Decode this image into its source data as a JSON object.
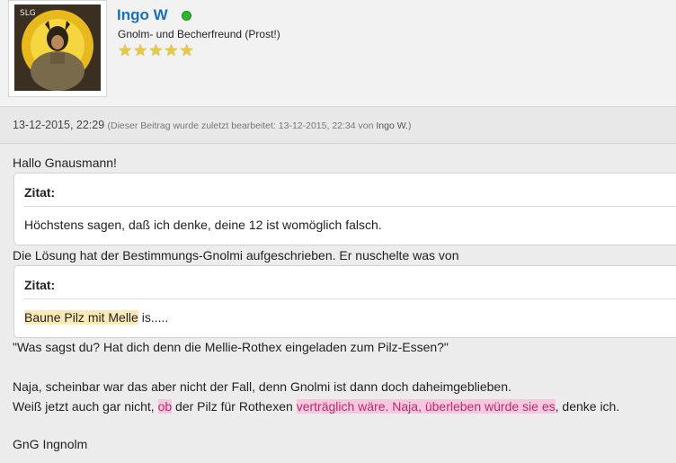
{
  "user": {
    "name": "Ingo W",
    "title": "Gnolm- und Becherfreund (Prost!)",
    "avatar_label": "SLG",
    "rating_stars": 5,
    "online_color": "#2fb52f"
  },
  "post": {
    "date": "13-12-2015, 22:29",
    "edit_prefix": "(Dieser Beitrag wurde zuletzt bearbeitet: 13-12-2015, 22:34 von",
    "edit_user": "Ingo W.",
    "edit_suffix": ")",
    "greeting": "Hallo Gnausmann!",
    "quote1": {
      "label": "Zitat:",
      "text": "Höchstens sagen, daß ich denke, deine 12 ist womöglich falsch."
    },
    "after_quote1": "Die Lösung hat der Bestimmungs-Gnolmi aufgeschrieben. Er nuschelte was von",
    "quote2": {
      "label": "Zitat:",
      "highlight": "Baune Pilz mit Melle",
      "rest": " is....."
    },
    "question": "\"Was sagst du? Hat dich denn die Mellie-Rothex eingeladen zum Pilz-Essen?\"",
    "line_naja": "Naja, scheinbar war das aber nicht der Fall, denn Gnolmi ist dann doch daheimgeblieben.",
    "line_weiss_a": "Weiß jetzt auch gar nicht, ",
    "line_weiss_hl1": "ob",
    "line_weiss_b": " der Pilz für Rothexen ",
    "line_weiss_hl2": "verträglich wäre. Naja, überleben würde sie es",
    "line_weiss_c": ", denke ich.",
    "signature": "GnG Ingnolm"
  },
  "colors": {
    "username": "#1c6fb3",
    "highlight_yellow": "#fbe9b8",
    "highlight_pink": "#f6c7df"
  }
}
